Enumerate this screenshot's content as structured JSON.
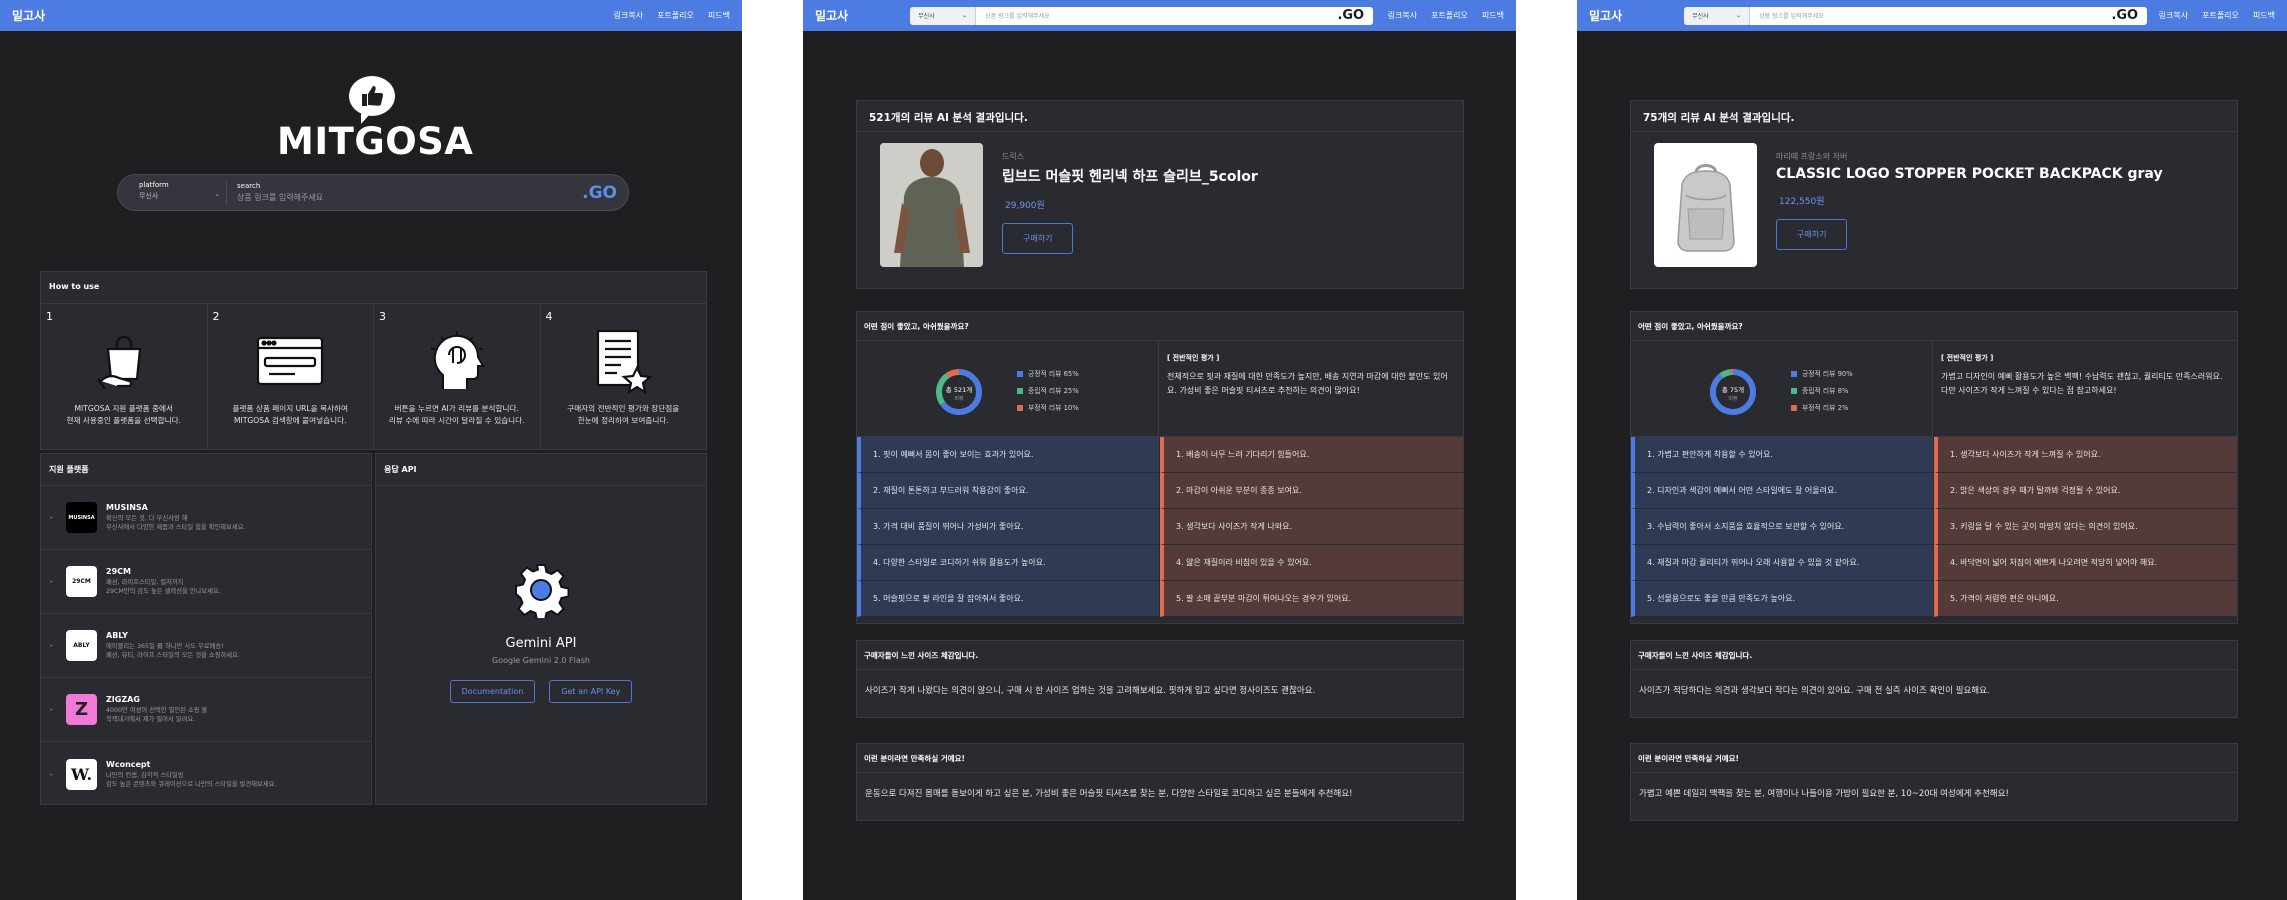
{
  "nav": {
    "brand": "밑고사",
    "links": [
      "링크복사",
      "포트폴리오",
      "피드백"
    ]
  },
  "home": {
    "logo_text": "MITGOSA",
    "search": {
      "platform_label": "platform",
      "platform_value": "무신사",
      "search_label": "search",
      "placeholder": "상품 링크를 입력해주세요",
      "go": ".GO"
    },
    "howto": {
      "title": "How to use",
      "steps": [
        {
          "num": "1",
          "icon": "shopping-bag-hand-icon",
          "text": "MITGOSA 지원 플랫폼 중에서\n현재 사용중인 플랫폼을 선택합니다."
        },
        {
          "num": "2",
          "icon": "browser-window-icon",
          "text": "플랫폼 상품 페이지 URL을 복사하여\nMITGOSA 검색창에 붙여넣습니다."
        },
        {
          "num": "3",
          "icon": "brain-head-icon",
          "text": "버튼을 누르면 AI가 리뷰를 분석합니다.\n리뷰 수에 따라 시간이 달라질 수 있습니다."
        },
        {
          "num": "4",
          "icon": "document-star-icon",
          "text": "구매자의 전반적인 평가와 장단점을\n한눈에 정리하여 보여줍니다."
        }
      ]
    },
    "platforms": {
      "title": "지원 플랫폼",
      "items": [
        {
          "name": "MUSINSA",
          "logo": "MUSINSA",
          "logo_bg": "#000000",
          "logo_fg": "#ffffff",
          "desc": "확신의 모든 것, 다 무신사랑 해\n무신사에서 다양한 제품과 스타일 힘을 확인해보세요."
        },
        {
          "name": "29CM",
          "logo": "29CM",
          "logo_bg": "#ffffff",
          "logo_fg": "#111111",
          "desc": "패션, 라이프스타일, 컬처까지\n29CM만의 감도 높은 셀렉션을 만나보세요."
        },
        {
          "name": "ABLY",
          "logo": "ABLY",
          "logo_bg": "#ffffff",
          "logo_fg": "#111111",
          "desc": "에이블리는 365일 毋 하나만 사도 무료배송!\n패션, 뷰티, 라이프 스타일의 모든 것을 쇼핑하세요."
        },
        {
          "name": "ZIGZAG",
          "logo": "Z",
          "logo_bg": "#f07ad6",
          "logo_fg": "#222222",
          "desc": "4000만 여성이 선택한 필인된 쇼핑 몰\n직잭대기에서 제가 필어서 알려요."
        },
        {
          "name": "Wconcept",
          "logo": "W.",
          "logo_bg": "#ffffff",
          "logo_fg": "#111111",
          "desc": "나만의 컨셉, 감각적 스타일링\n감도 높은 콘텐츠와 큐레이션으로 나만의 스타일을 발견해보세요."
        }
      ]
    },
    "api": {
      "title": "응답 API",
      "name": "Gemini API",
      "model": "Google Gemini 2.0 Flash",
      "doc_btn": "Documentation",
      "key_btn": "Get an API Key"
    }
  },
  "result1": {
    "search": {
      "platform": "무신사",
      "placeholder": "상품 링크를 입력해주세요",
      "go": ".GO"
    },
    "header": "521개의 리뷰 AI 분석 결과입니다.",
    "product": {
      "category": "드릭스",
      "name": "립브드 머슬핏 헨리넥 하프 슬리브_5color",
      "price": "29,900원",
      "buy": "구매하기"
    },
    "question": "어떤 점이 좋았고, 아쉬웠을까요?",
    "donut": {
      "center_top": "총 521개",
      "center_bottom": "리뷰",
      "positive": 65,
      "neutral": 25,
      "negative": 10
    },
    "legend": [
      "긍정적 리뷰 65%",
      "중립적 리뷰 25%",
      "부정적 리뷰 10%"
    ],
    "overall_title": "[ 전반적인 평가 ]",
    "overall_text": "전체적으로 핏과 재질에 대한 만족도가 높지만, 배송 지연과 마감에 대한 불만도 있어요. 가성비 좋은 머슬핏 티셔츠로 추천하는 의견이 많아요!",
    "pros": [
      "1. 핏이 예뻐서 몸이 좋아 보이는 효과가 있어요.",
      "2. 재질이 톤톤하고 부드러워 착용감이 좋아요.",
      "3. 가격 대비 품질이 뛰어나 가성비가 좋아요.",
      "4. 다양한 스타일로 코디하기 쉬워 활용도가 높아요.",
      "5. 머슬핏으로 팔 라인을 잘 잡아줘서 좋아요."
    ],
    "cons": [
      "1. 배송이 너무 느려 기다리기 힘들어요.",
      "2. 마감이 아쉬운 부분이 종종 보여요.",
      "3. 생각보다 사이즈가 작게 나와요.",
      "4. 얇은 재질이라 비침이 있을 수 있어요.",
      "5. 팔 소매 끝부분 마감이 튀어나오는 경우가 있어요."
    ],
    "size_title": "구매자들이 느낀 사이즈 체감입니다.",
    "size_text": "사이즈가 작게 나왔다는 의견이 많으니, 구매 시 한 사이즈 업하는 것을 고려해보세요. 핏하게 입고 싶다면 정사이즈도 괜찮아요.",
    "rec_title": "이런 분이라면 만족하실 거예요!",
    "rec_text": "운동으로 다져진 몸매를 돋보이게 하고 싶은 분, 가성비 좋은 머슬핏 티셔츠를 찾는 분, 다양한 스타일로 코디하고 싶은 분들에게 추천해요!"
  },
  "result2": {
    "search": {
      "platform": "무신사",
      "placeholder": "상품 링크를 입력해주세요",
      "go": ".GO"
    },
    "header": "75개의 리뷰 AI 분석 결과입니다.",
    "product": {
      "category": "마리떼 프랑소와 저버",
      "name": "CLASSIC LOGO STOPPER POCKET BACKPACK gray",
      "price": "122,550원",
      "buy": "구매하기"
    },
    "question": "어떤 점이 좋았고, 아쉬웠을까요?",
    "donut": {
      "center_top": "총 75개",
      "center_bottom": "리뷰",
      "positive": 90,
      "neutral": 8,
      "negative": 2
    },
    "legend": [
      "긍정적 리뷰 90%",
      "중립적 리뷰 8%",
      "부정적 리뷰 2%"
    ],
    "overall_title": "[ 전반적인 평가 ]",
    "overall_text": "가볍고 디자인이 예뻐 활용도가 높은 백팩! 수납력도 괜찮고, 퀄리티도 만족스러워요. 다만 사이즈가 작게 느껴질 수 있다는 점 참고하세요!",
    "pros": [
      "1. 가볍고 편안하게 착용할 수 있어요.",
      "2. 디자인과 색감이 예뻐서 어떤 스타일에도 잘 어울려요.",
      "3. 수납력이 좋아서 소지품을 효율적으로 보관할 수 있어요.",
      "4. 재질과 마감 퀄리티가 뛰어나 오래 사용할 수 있을 것 같아요.",
      "5. 선물용으로도 좋을 만큼 만족도가 높아요."
    ],
    "cons": [
      "1. 생각보다 사이즈가 작게 느껴질 수 있어요.",
      "2. 밝은 색상의 경우 때가 탈까봐 걱정될 수 있어요.",
      "3. 키링을 달 수 있는 곳이 마땅치 않다는 의견이 있어요.",
      "4. 바닥면이 넓어 처짐이 예쁘게 나오려면 적당히 넣어야 해요.",
      "5. 가격이 저렴한 편은 아니에요."
    ],
    "size_title": "구매자들이 느낀 사이즈 체감입니다.",
    "size_text": "사이즈가 적당하다는 의견과 생각보다 작다는 의견이 있어요. 구매 전 실측 사이즈 확인이 필요해요.",
    "rec_title": "이런 분이라면 만족하실 거예요!",
    "rec_text": "가볍고 예쁜 데일리 백팩을 찾는 분, 여행이나 나들이용 가방이 필요한 분, 10~20대 여성에게 추천해요!"
  },
  "colors": {
    "accent": "#4c7be2",
    "positive": "#4c7be2",
    "neutral": "#4fb889",
    "negative": "#e06b52"
  }
}
